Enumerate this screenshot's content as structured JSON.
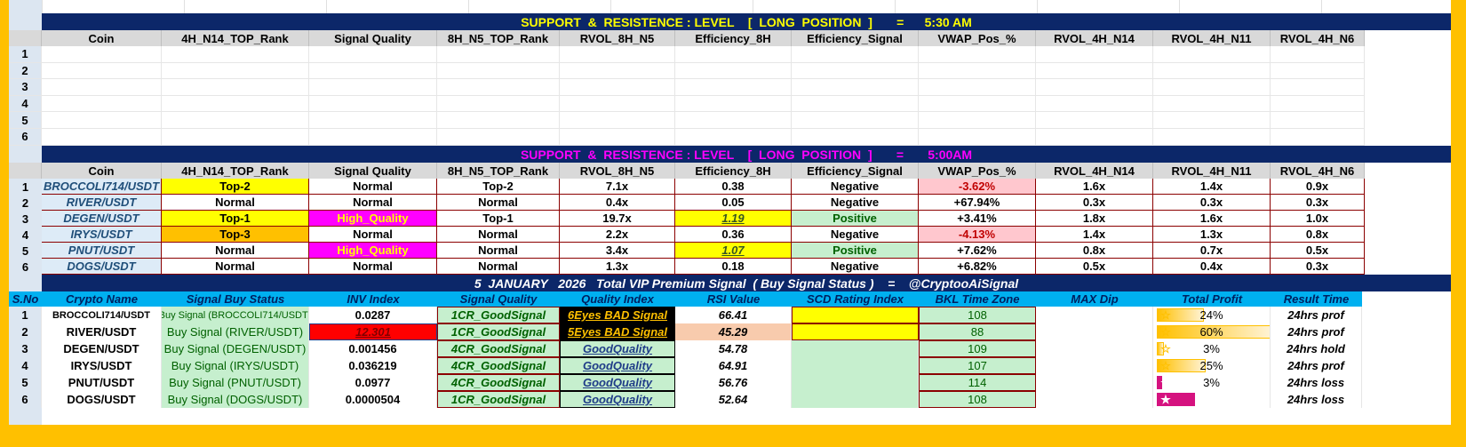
{
  "top_table": {
    "title_prefix": "SUPPORT  &  RESISTENCE : LEVEL    [  LONG  POSITION  ]       =",
    "title_time": "      5:30 AM",
    "headers": [
      "Coin",
      "4H_N14_TOP_Rank",
      "Signal Quality",
      "8H_N5_TOP_Rank",
      "RVOL_8H_N5",
      "Efficiency_8H",
      "Efficiency_Signal",
      "VWAP_Pos_%",
      "RVOL_4H_N14",
      "RVOL_4H_N11",
      "RVOL_4H_N6"
    ],
    "row_numbers": [
      "1",
      "2",
      "3",
      "4",
      "5",
      "6"
    ]
  },
  "mid_table": {
    "title": "SUPPORT  &  RESISTENCE : LEVEL    [  LONG  POSITION  ]       =       5:00AM",
    "headers": [
      "Coin",
      "4H_N14_TOP_Rank",
      "Signal Quality",
      "8H_N5_TOP_Rank",
      "RVOL_8H_N5",
      "Efficiency_8H",
      "Efficiency_Signal",
      "VWAP_Pos_%",
      "RVOL_4H_N14",
      "RVOL_4H_N11",
      "RVOL_4H_N6"
    ],
    "rows": [
      {
        "n": "1",
        "coin": "BROCCOLI714/USDT",
        "rank4h": "Top-2",
        "quality": "Normal",
        "rank8h": "Top-2",
        "rvol8h": "7.1x",
        "eff": "0.38",
        "effsig": "Negative",
        "vwap": "-3.62%",
        "r14": "1.6x",
        "r11": "1.4x",
        "r6": "0.9x"
      },
      {
        "n": "2",
        "coin": "RIVER/USDT",
        "rank4h": "Normal",
        "quality": "Normal",
        "rank8h": "Normal",
        "rvol8h": "0.4x",
        "eff": "0.05",
        "effsig": "Negative",
        "vwap": "+67.94%",
        "r14": "0.3x",
        "r11": "0.3x",
        "r6": "0.3x"
      },
      {
        "n": "3",
        "coin": "DEGEN/USDT",
        "rank4h": "Top-1",
        "quality": "High_Quality",
        "rank8h": "Top-1",
        "rvol8h": "19.7x",
        "eff": "1.19",
        "effsig": "Positive",
        "vwap": "+3.41%",
        "r14": "1.8x",
        "r11": "1.6x",
        "r6": "1.0x"
      },
      {
        "n": "4",
        "coin": "IRYS/USDT",
        "rank4h": "Top-3",
        "quality": "Normal",
        "rank8h": "Normal",
        "rvol8h": "2.2x",
        "eff": "0.36",
        "effsig": "Negative",
        "vwap": "-4.13%",
        "r14": "1.4x",
        "r11": "1.3x",
        "r6": "0.8x"
      },
      {
        "n": "5",
        "coin": "PNUT/USDT",
        "rank4h": "Normal",
        "quality": "High_Quality",
        "rank8h": "Normal",
        "rvol8h": "3.4x",
        "eff": "1.07",
        "effsig": "Positive",
        "vwap": "+7.62%",
        "r14": "0.8x",
        "r11": "0.7x",
        "r6": "0.5x"
      },
      {
        "n": "6",
        "coin": "DOGS/USDT",
        "rank4h": "Normal",
        "quality": "Normal",
        "rank8h": "Normal",
        "rvol8h": "1.3x",
        "eff": "0.18",
        "effsig": "Negative",
        "vwap": "+6.82%",
        "r14": "0.5x",
        "r11": "0.4x",
        "r6": "0.3x"
      }
    ]
  },
  "signal_table": {
    "title": "5  JANUARY   2026   Total VIP Premium Signal  ( Buy Signal Status )    =    @CryptooAiSignal",
    "headers": [
      "S.No",
      "Crypto Name",
      "Signal Buy Status",
      "INV  Index",
      "Signal Quality",
      "Quality Index",
      "RSI Value",
      "SCD  Rating Index",
      "BKL Time Zone",
      "MAX Dip",
      "Total Profit",
      "Result Time"
    ],
    "rows": [
      {
        "n": "1",
        "name": "BROCCOLI714/USDT",
        "status": "Buy Signal (BROCCOLI714/USDT)",
        "inv": "0.0287",
        "sq": "1CR_GoodSignal",
        "qi": "6Eyes  BAD  Signal",
        "rsi": "66.41",
        "bkl": "108",
        "profit": "24%",
        "profit_value": 24,
        "result": "24hrs prof"
      },
      {
        "n": "2",
        "name": "RIVER/USDT",
        "status": "Buy Signal (RIVER/USDT)",
        "inv": "12.301",
        "sq": "1CR_GoodSignal",
        "qi": "5Eyes  BAD  Signal",
        "rsi": "45.29",
        "bkl": "88",
        "profit": "60%",
        "profit_value": 60,
        "result": "24hrs prof"
      },
      {
        "n": "3",
        "name": "DEGEN/USDT",
        "status": "Buy Signal (DEGEN/USDT)",
        "inv": "0.001456",
        "sq": "4CR_GoodSignal",
        "qi": "GoodQuality",
        "rsi": "54.78",
        "bkl": "109",
        "profit": "3%",
        "profit_value": 3,
        "result": "24hrs hold"
      },
      {
        "n": "4",
        "name": "IRYS/USDT",
        "status": "Buy Signal (IRYS/USDT)",
        "inv": "0.036219",
        "sq": "4CR_GoodSignal",
        "qi": "GoodQuality",
        "rsi": "64.91",
        "bkl": "107",
        "profit": "25%",
        "profit_value": 25,
        "result": "24hrs prof"
      },
      {
        "n": "5",
        "name": "PNUT/USDT",
        "status": "Buy Signal (PNUT/USDT)",
        "inv": "0.0977",
        "sq": "4CR_GoodSignal",
        "qi": "GoodQuality",
        "rsi": "56.76",
        "bkl": "114",
        "profit": "3%",
        "profit_value": 3,
        "result": "24hrs loss"
      },
      {
        "n": "6",
        "name": "DOGS/USDT",
        "status": "Buy Signal (DOGS/USDT)",
        "inv": "0.0000504",
        "sq": "1CR_GoodSignal",
        "qi": "GoodQuality",
        "rsi": "52.64",
        "bkl": "108",
        "profit": "20%",
        "profit_value": 20,
        "result": "24hrs loss"
      }
    ]
  },
  "colors": {
    "navy": "#0c2769",
    "yellow_title": "#ffff00",
    "magenta_title": "#ff00ff",
    "cyan_header": "#00b0f0"
  }
}
